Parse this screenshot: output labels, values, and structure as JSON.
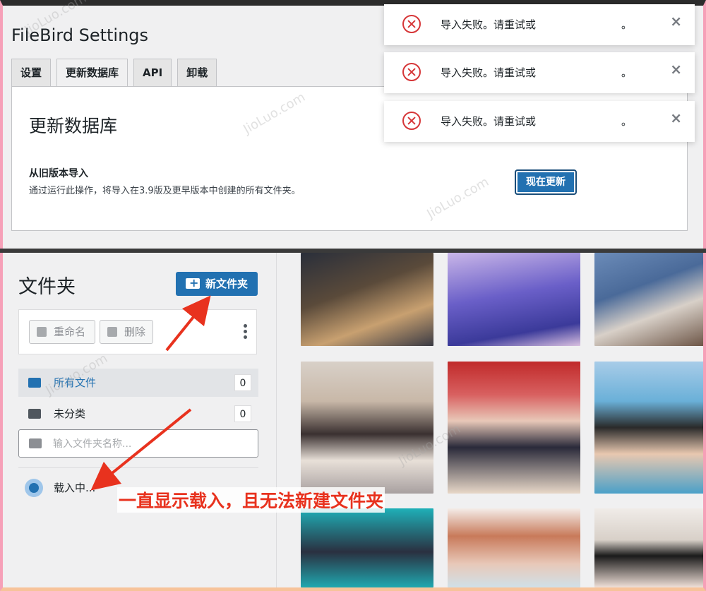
{
  "settings": {
    "title": "FileBird Settings",
    "tabs": [
      {
        "label": "设置"
      },
      {
        "label": "更新数据库"
      },
      {
        "label": "API"
      },
      {
        "label": "卸载"
      }
    ],
    "panel_title": "更新数据库",
    "import_label": "从旧版本导入",
    "import_desc": "通过运行此操作，将导入在3.9版及更早版本中创建的所有文件夹。",
    "update_button": "现在更新"
  },
  "toasts": [
    {
      "message": "导入失败。请重试或",
      "tail": "。",
      "close": "×"
    },
    {
      "message": "导入失败。请重试或",
      "tail": "。",
      "close": "×"
    },
    {
      "message": "导入失败。请重试或",
      "tail": "。",
      "close": "×"
    }
  ],
  "folders": {
    "title": "文件夹",
    "new_folder_button": "新文件夹",
    "rename_button": "重命名",
    "delete_button": "删除",
    "all_files": {
      "label": "所有文件",
      "count": "0"
    },
    "uncategorized": {
      "label": "未分类",
      "count": "0"
    },
    "search_placeholder": "输入文件夹名称...",
    "loading_text": "载入中..."
  },
  "annotation_text": "一直显示载入，且无法新建文件夹",
  "watermark_text": "JioLuo.com",
  "colors": {
    "primary": "#2271b1",
    "error": "#d63638",
    "annotation": "#e8321e",
    "frame_pink": "#f6a0b8"
  }
}
